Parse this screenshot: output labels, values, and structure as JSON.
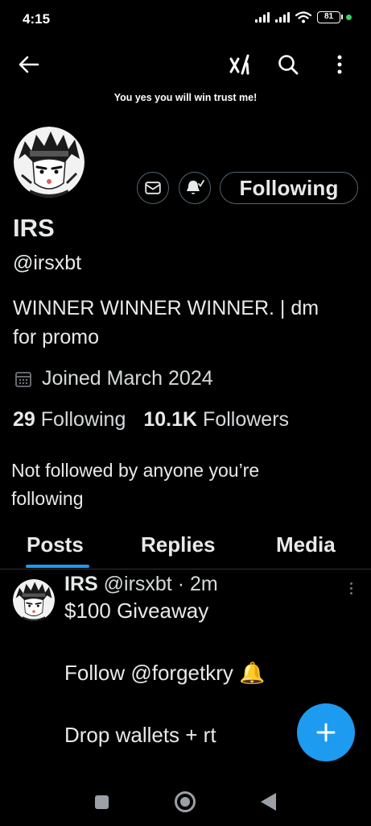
{
  "status_bar": {
    "time": "4:15",
    "battery": "81",
    "icons": [
      "cellular-signal-icon",
      "cellular-signal-icon",
      "wifi-icon",
      "battery-icon",
      "privacy-dot-icon"
    ]
  },
  "header": {
    "icons": [
      "back-arrow-icon",
      "grok-icon",
      "search-icon",
      "more-vertical-icon"
    ],
    "banner_text": "You yes you will win trust me!"
  },
  "profile": {
    "display_name": "IRS",
    "handle": "@irsxbt",
    "bio_line1": "WINNER WINNER WINNER. | dm",
    "bio_line2": "for promo",
    "joined": "Joined March 2024",
    "following_count": "29",
    "following_label": "Following",
    "followers_count": "10.1K",
    "followers_label": "Followers",
    "not_followed_line1": "Not followed by anyone you’re",
    "not_followed_line2": "following",
    "follow_button_label": "Following"
  },
  "tabs": [
    {
      "label": "Posts",
      "active": true
    },
    {
      "label": "Replies",
      "active": false
    },
    {
      "label": "Media",
      "active": false
    }
  ],
  "post": {
    "name": "IRS",
    "handle": "@irsxbt",
    "separator": "·",
    "time": "2m",
    "line1": "$100 Giveaway",
    "line2": "Follow @forgetkry 🔔",
    "line3": "Drop wallets + rt"
  },
  "colors": {
    "background": "#000000",
    "accent": "#1d9bf0",
    "text": "#e7e9ea",
    "border": "#536471"
  }
}
